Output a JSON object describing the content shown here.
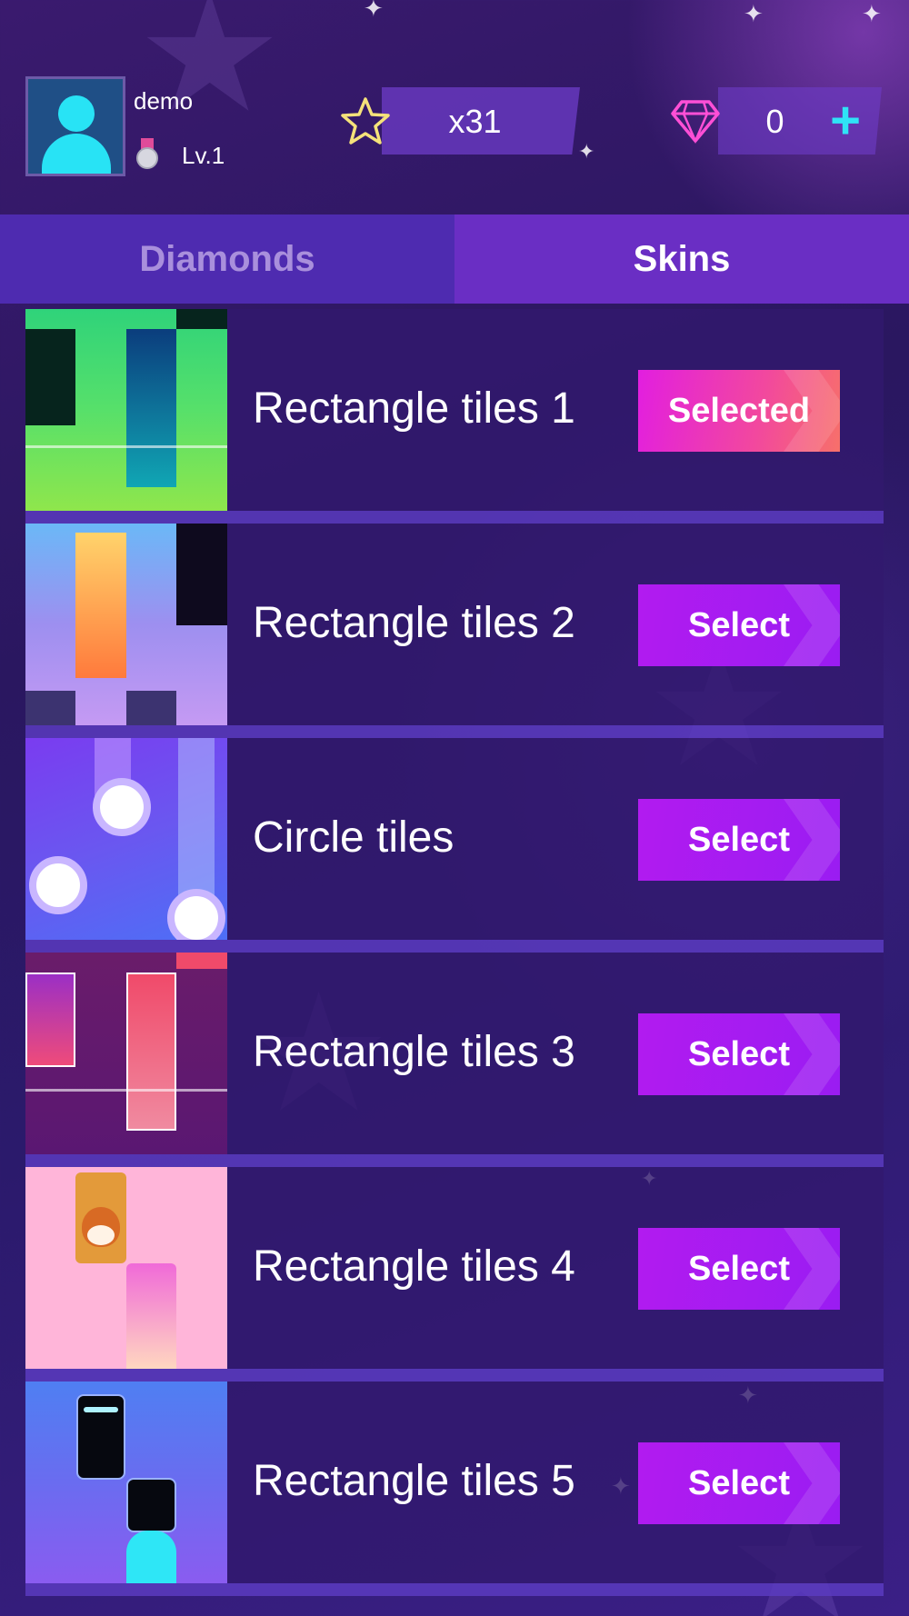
{
  "header": {
    "username": "demo",
    "level": "Lv.1",
    "stars": "x31",
    "diamonds": "0",
    "plus_label": "+"
  },
  "tabs": [
    {
      "label": "Diamonds",
      "active": false
    },
    {
      "label": "Skins",
      "active": true
    }
  ],
  "skins": [
    {
      "title": "Rectangle tiles 1",
      "button": "Selected",
      "state": "selected"
    },
    {
      "title": "Rectangle tiles 2",
      "button": "Select",
      "state": "available"
    },
    {
      "title": "Circle tiles",
      "button": "Select",
      "state": "available"
    },
    {
      "title": "Rectangle tiles 3",
      "button": "Select",
      "state": "available"
    },
    {
      "title": "Rectangle tiles 4",
      "button": "Select",
      "state": "available"
    },
    {
      "title": "Rectangle tiles 5",
      "button": "Select",
      "state": "available"
    }
  ],
  "colors": {
    "accent_cyan": "#2fe3f6",
    "select_button": "#a01cf2",
    "selected_button": "#f2489e",
    "tab_active": "#6a2ec4",
    "tab_inactive": "#4e2bb0"
  },
  "icons": {
    "star": "star-outline-icon",
    "diamond": "diamond-icon",
    "medal": "medal-icon",
    "avatar": "user-avatar-icon"
  }
}
